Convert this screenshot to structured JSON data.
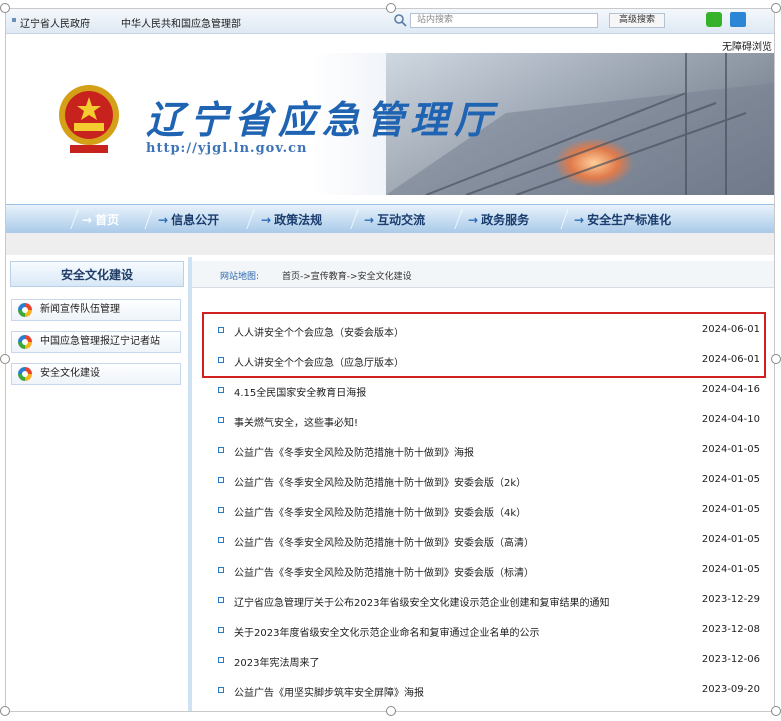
{
  "topbar": {
    "links": [
      "辽宁省人民政府",
      "中华人民共和国应急管理部"
    ],
    "search_placeholder": "站内搜索",
    "advanced_search": "高级搜索",
    "accessibility": "无障碍浏览"
  },
  "banner": {
    "title": "辽宁省应急管理厅",
    "url": "http://yjgl.ln.gov.cn"
  },
  "nav": {
    "items": [
      "首页",
      "信息公开",
      "政策法规",
      "互动交流",
      "政务服务",
      "安全生产标准化"
    ]
  },
  "sidebar": {
    "title": "安全文化建设",
    "items": [
      "新闻宣传队伍管理",
      "中国应急管理报辽宁记者站",
      "安全文化建设"
    ]
  },
  "breadcrumb": {
    "label": "网站地图:",
    "path": "首页->宣传教育->安全文化建设"
  },
  "articles": [
    {
      "title": "人人讲安全个个会应急（安委会版本）",
      "date": "2024-06-01"
    },
    {
      "title": "人人讲安全个个会应急（应急厅版本）",
      "date": "2024-06-01"
    },
    {
      "title": "4.15全民国家安全教育日海报",
      "date": "2024-04-16"
    },
    {
      "title": "事关燃气安全，这些事必知!",
      "date": "2024-04-10"
    },
    {
      "title": "公益广告《冬季安全风险及防范措施十防十做到》海报",
      "date": "2024-01-05"
    },
    {
      "title": "公益广告《冬季安全风险及防范措施十防十做到》安委会版（2k）",
      "date": "2024-01-05"
    },
    {
      "title": "公益广告《冬季安全风险及防范措施十防十做到》安委会版（4k）",
      "date": "2024-01-05"
    },
    {
      "title": "公益广告《冬季安全风险及防范措施十防十做到》安委会版（高清）",
      "date": "2024-01-05"
    },
    {
      "title": "公益广告《冬季安全风险及防范措施十防十做到》安委会版（标清）",
      "date": "2024-01-05"
    },
    {
      "title": "辽宁省应急管理厅关于公布2023年省级安全文化建设示范企业创建和复审结果的通知",
      "date": "2023-12-29"
    },
    {
      "title": "关于2023年度省级安全文化示范企业命名和复审通过企业名单的公示",
      "date": "2023-12-08"
    },
    {
      "title": "2023年宪法周来了",
      "date": "2023-12-06"
    },
    {
      "title": "公益广告《用坚实脚步筑牢安全屏障》海报",
      "date": "2023-09-20"
    }
  ],
  "colors": {
    "accent": "#1f63b3",
    "highlight_border": "#d0201f",
    "nav_gradient": "#a9cae9"
  }
}
